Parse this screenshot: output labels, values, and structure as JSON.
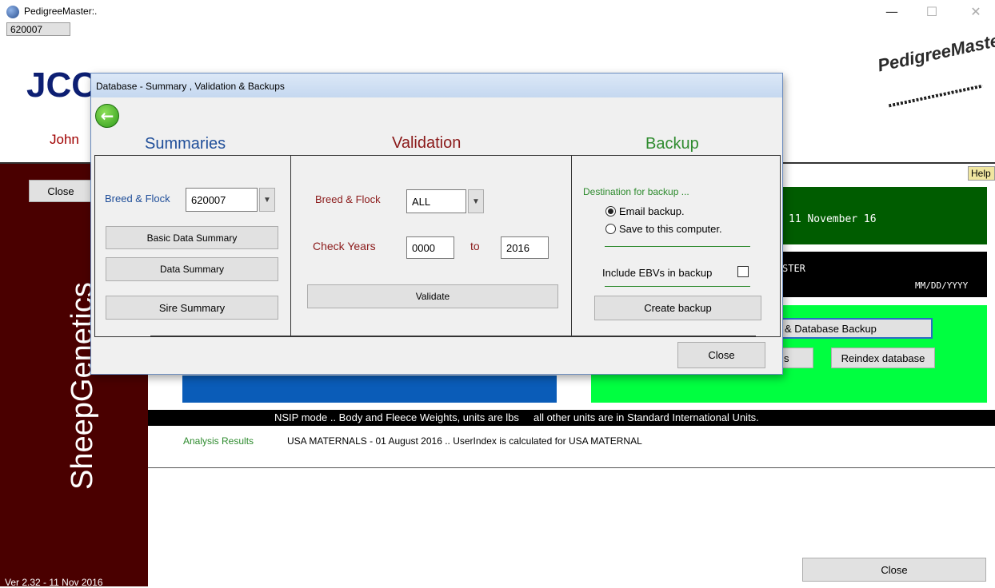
{
  "window": {
    "title": "PedigreeMaster:.",
    "minimize": "—",
    "maximize": "☐",
    "close": "✕"
  },
  "main": {
    "flock_id": "620007",
    "logo_text": "JCC",
    "owner_name": "John",
    "side_close": "Close",
    "brand_vertical": "SheepGenetics",
    "pedigree_logo": "PedigreeMaste",
    "help": "Help",
    "date_text": "11 November 16",
    "black_panel_text": "STER",
    "date_format": "MM/DD/YYYY",
    "backup_button": "& Database Backup",
    "s_button": "s",
    "reindex_button": "Reindex database",
    "nsip_bar": "NSIP mode .. Body and Fleece Weights, units are lbs     all other units are in Standard International Units.",
    "analysis_label": "Analysis Results",
    "analysis_text": "USA MATERNALS - 01 August 2016  .. UserIndex is calculated for USA MATERNAL",
    "version": "Ver 2.32 -  11 Nov 2016",
    "bottom_close": "Close"
  },
  "dialog": {
    "title": "Database - Summary , Validation  & Backups",
    "back_icon": "back-arrow-icon",
    "summaries": {
      "heading": "Summaries",
      "breed_flock_label": "Breed & Flock",
      "breed_flock_value": "620007",
      "basic_data_summary": "Basic Data Summary",
      "data_summary": "Data Summary",
      "sire_summary": "Sire Summary"
    },
    "validation": {
      "heading": "Validation",
      "breed_flock_label": "Breed & Flock",
      "breed_flock_value": "ALL",
      "check_years_label": "Check Years",
      "year_from": "0000",
      "to_label": "to",
      "year_to": "2016",
      "validate_button": "Validate"
    },
    "backup": {
      "heading": "Backup",
      "destination_label": "Destination for backup ...",
      "option_email": "Email backup.",
      "option_save": "Save to this computer.",
      "selected_option": "email",
      "include_ebvs_label": "Include EBVs in backup",
      "include_ebvs_checked": false,
      "create_backup_button": "Create backup"
    },
    "close_button": "Close"
  },
  "colors": {
    "maroon": "#4a0000",
    "dark_green": "#005c00",
    "bright_green": "#00ff40",
    "blue": "#0a5cb8",
    "summaries_blue": "#1f4e99",
    "validation_red": "#8b1a1a",
    "backup_green": "#2e8b2e"
  }
}
